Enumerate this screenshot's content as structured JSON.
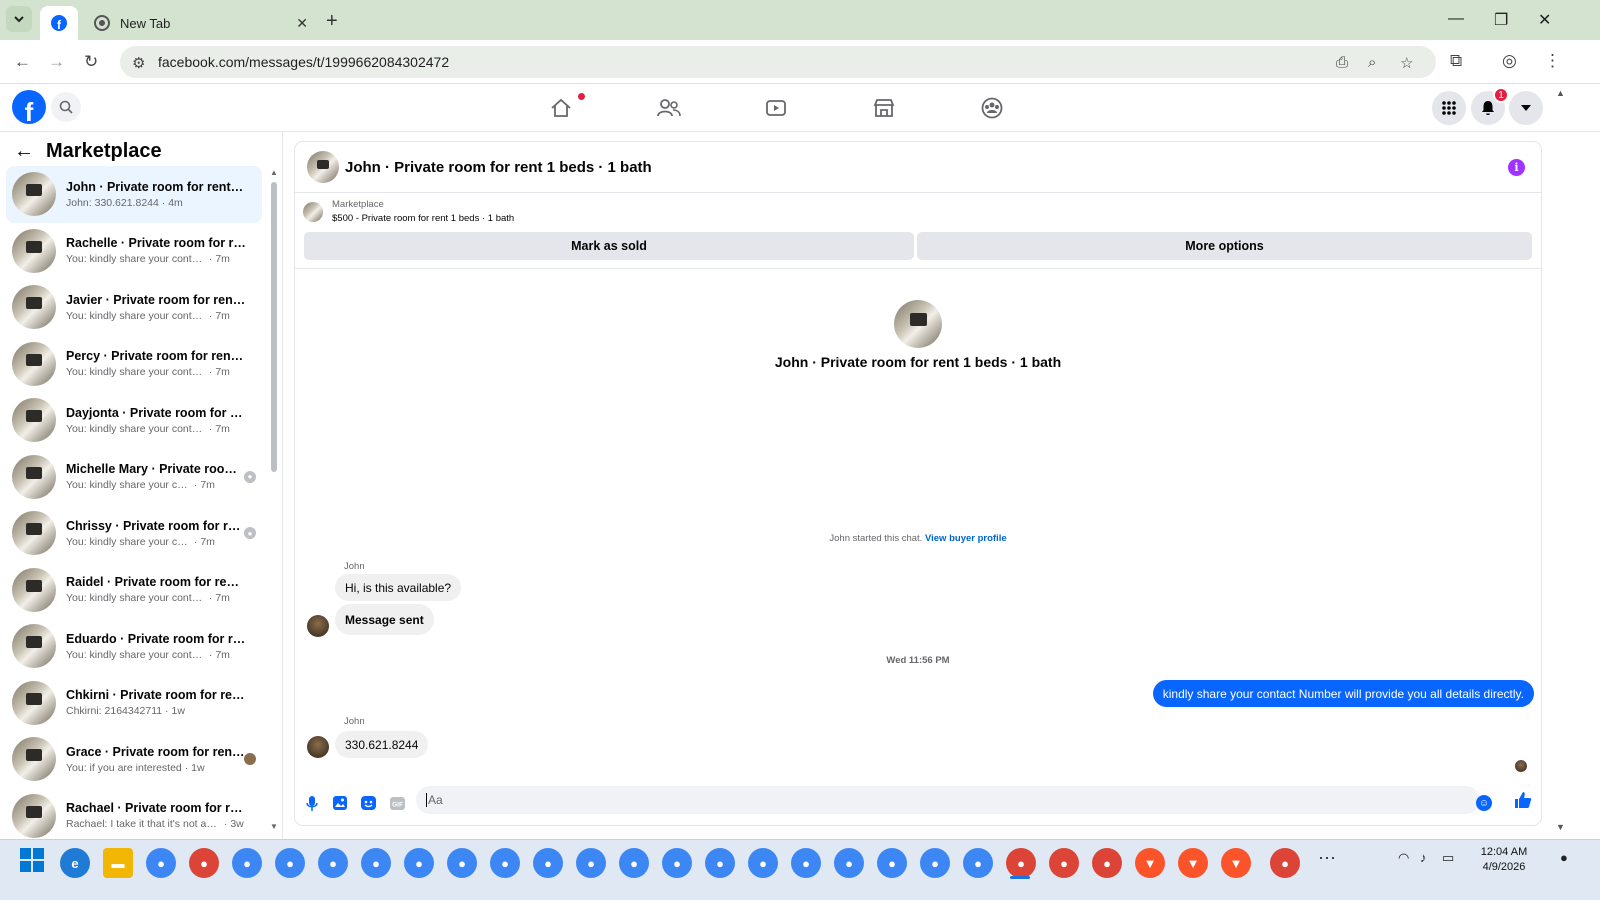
{
  "browser": {
    "tabs": [
      {
        "title": "",
        "icon": "facebook-icon",
        "active": true
      },
      {
        "title": "New Tab",
        "icon": "chrome-icon",
        "active": false
      }
    ],
    "url": "facebook.com/messages/t/1999662084302472"
  },
  "fb_header": {
    "notification_count": "1"
  },
  "sidebar": {
    "title": "Marketplace",
    "conversations": [
      {
        "name": "John · Private room for rent 1 b...",
        "preview": "John: 330.621.8244",
        "time": "4m",
        "active": true,
        "status": ""
      },
      {
        "name": "Rachelle · Private room for rent ...",
        "preview": "You: kindly share your contact Nu...",
        "time": "7m",
        "status": ""
      },
      {
        "name": "Javier · Private room for rent 1 b...",
        "preview": "You: kindly share your contact Nu...",
        "time": "7m",
        "status": ""
      },
      {
        "name": "Percy · Private room for rent 1 b...",
        "preview": "You: kindly share your contact Nu...",
        "time": "7m",
        "status": ""
      },
      {
        "name": "Dayjonta · Private room for rent...",
        "preview": "You: kindly share your contact Nu...",
        "time": "7m",
        "status": ""
      },
      {
        "name": "Michelle Mary · Private room ...",
        "preview": "You: kindly share your contact ...",
        "time": "7m",
        "status": "seen-default"
      },
      {
        "name": "Chrissy · Private room for ren...",
        "preview": "You: kindly share your contact ...",
        "time": "7m",
        "status": "seen-default"
      },
      {
        "name": "Raidel · Private room for rent 1 ...",
        "preview": "You: kindly share your contact Nu...",
        "time": "7m",
        "status": ""
      },
      {
        "name": "Eduardo · Private room for rent ...",
        "preview": "You: kindly share your contact Nu...",
        "time": "7m",
        "status": ""
      },
      {
        "name": "Chkirni · Private room for rent 1...",
        "preview": "Chkirni: 2164342711",
        "time": "1w",
        "status": ""
      },
      {
        "name": "Grace · Private room for rent ...",
        "preview": "You: if you are interested",
        "time": "1w",
        "status": "seen-photo"
      },
      {
        "name": "Rachael · Private room for rent ...",
        "preview": "Rachael: I take it that it's not avail...",
        "time": "3w",
        "status": ""
      }
    ]
  },
  "chat": {
    "title": "John · Private room for rent 1 beds · 1 bath",
    "listing_label": "Marketplace",
    "listing_detail": "$500 - Private room for rent 1 beds · 1 bath",
    "mark_sold": "Mark as sold",
    "more_options": "More options",
    "intro_title": "John · Private room for rent 1 beds · 1 bath",
    "started_text": "John started this chat.",
    "view_profile": "View buyer profile",
    "messages": [
      {
        "sender": "John",
        "text": "Hi, is this available?"
      },
      {
        "text": "Message sent"
      },
      {
        "timestamp": "Wed 11:56 PM"
      },
      {
        "sender": "You",
        "text": "kindly share your contact Number will provide you all details directly."
      },
      {
        "sender": "John",
        "text": "330.621.8244"
      }
    ],
    "composer_placeholder": "Aa"
  },
  "taskbar": {
    "time": "12:04 AM",
    "date": "4/9/2026"
  }
}
